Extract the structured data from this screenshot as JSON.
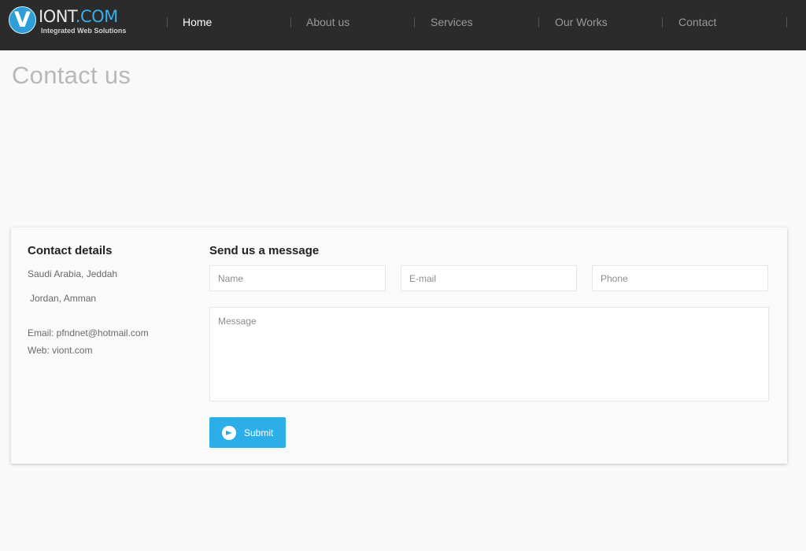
{
  "logo": {
    "letter": "V",
    "word_a": "IONT",
    "word_b": ".COM",
    "tagline": "Integrated Web Solutions"
  },
  "nav": [
    {
      "label": "Home",
      "active": true
    },
    {
      "label": "About us"
    },
    {
      "label": "Services"
    },
    {
      "label": "Our Works"
    },
    {
      "label": "Contact"
    }
  ],
  "page_title": "Contact us",
  "contact": {
    "title": "Contact details",
    "address1": "Saudi Arabia, Jeddah",
    "address2": "Jordan, Amman",
    "email": "Email: pfndnet@hotmail.com",
    "web": "Web: viont.com"
  },
  "form": {
    "title": "Send us a message",
    "name_placeholder": "Name",
    "email_placeholder": "E-mail",
    "phone_placeholder": "Phone",
    "message_placeholder": "Message",
    "submit_label": "Submit"
  },
  "colors": {
    "header_bg": "#2b2b2b",
    "accent": "#2caee9",
    "page_bg": "#f9f9f9"
  }
}
